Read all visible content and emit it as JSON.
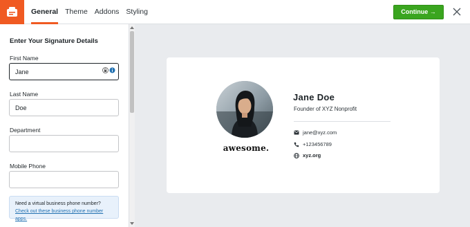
{
  "header": {
    "tabs": [
      {
        "label": "General",
        "active": true
      },
      {
        "label": "Theme",
        "active": false
      },
      {
        "label": "Addons",
        "active": false
      },
      {
        "label": "Styling",
        "active": false
      }
    ],
    "continue_label": "Continue →",
    "accent_color": "#f05a22",
    "continue_color": "#3aa51f"
  },
  "sidebar": {
    "heading": "Enter Your Signature Details",
    "fields": {
      "first_name": {
        "label": "First Name",
        "value": "Jane"
      },
      "last_name": {
        "label": "Last Name",
        "value": "Doe"
      },
      "department": {
        "label": "Department",
        "value": ""
      },
      "mobile_phone": {
        "label": "Mobile Phone",
        "value": ""
      }
    },
    "notice": {
      "text": "Need a virtual business phone number? ",
      "link": "Check out these business phone number apps."
    }
  },
  "preview": {
    "brand": "awesome.",
    "name": "Jane Doe",
    "title": "Founder of XYZ Nonprofit",
    "email": "jane@xyz.com",
    "phone": "+123456789",
    "website": "xyz.org"
  }
}
